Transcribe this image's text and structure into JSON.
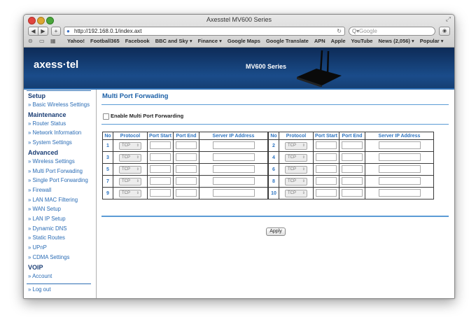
{
  "browser": {
    "window_title": "Axesstel MV600 Series",
    "back_glyph": "◀",
    "forward_glyph": "▶",
    "plus_glyph": "+",
    "url": "http://192.168.0.1/index.axt",
    "reload_glyph": "↻",
    "search_placeholder": "Google",
    "search_glyph": "Q▾",
    "bookmarks": [
      "Yahoo!",
      "Football365",
      "Facebook",
      "BBC and Sky ▾",
      "Finance ▾",
      "Google Maps",
      "Google Translate",
      "APN",
      "Apple",
      "YouTube",
      "News (2,056) ▾",
      "Popular ▾"
    ]
  },
  "banner": {
    "logo": "axess·tel",
    "model": "MV600 Series"
  },
  "sidebar": {
    "sections": [
      {
        "title": "Setup",
        "items": [
          "» Basic Wireless Settings"
        ]
      },
      {
        "title": "Maintenance",
        "items": [
          "» Router Status",
          "» Network Information",
          "» System Settings"
        ]
      },
      {
        "title": "Advanced",
        "items": [
          "» Wireless Settings",
          "» Multi Port Forwading",
          "» Single Port Forwarding",
          "» Firewall",
          "» LAN MAC Filtering",
          "» WAN Setup",
          "» LAN IP Setup",
          "» Dynamic DNS",
          "» Static Routes",
          "» UPnP",
          "» CDMA Settings"
        ]
      },
      {
        "title": "VOIP",
        "items": [
          "» Account"
        ]
      }
    ],
    "logout": "» Log out"
  },
  "main": {
    "title": "Multi Port Forwading",
    "enable_label": "Enable Multi Port Forwarding",
    "enable_checked": false,
    "headers": [
      "No",
      "Protocol",
      "Port Start",
      "Port End",
      "Server IP Address",
      "No",
      "Protocol",
      "Port Start",
      "Port End",
      "Server IP Address"
    ],
    "rows": [
      {
        "left": {
          "no": "1",
          "protocol": "TCP"
        },
        "right": {
          "no": "2",
          "protocol": "TCP"
        }
      },
      {
        "left": {
          "no": "3",
          "protocol": "TCP"
        },
        "right": {
          "no": "4",
          "protocol": "TCP"
        }
      },
      {
        "left": {
          "no": "5",
          "protocol": "TCP"
        },
        "right": {
          "no": "6",
          "protocol": "TCP"
        }
      },
      {
        "left": {
          "no": "7",
          "protocol": "TCP"
        },
        "right": {
          "no": "8",
          "protocol": "TCP"
        }
      },
      {
        "left": {
          "no": "9",
          "protocol": "TCP"
        },
        "right": {
          "no": "10",
          "protocol": "TCP"
        }
      }
    ],
    "apply_label": "Apply"
  },
  "colors": {
    "banner": "#1a4c8a",
    "accent_blue": "#2c73c0",
    "section_title": "#1b3e75",
    "link": "#2a6cb5"
  }
}
